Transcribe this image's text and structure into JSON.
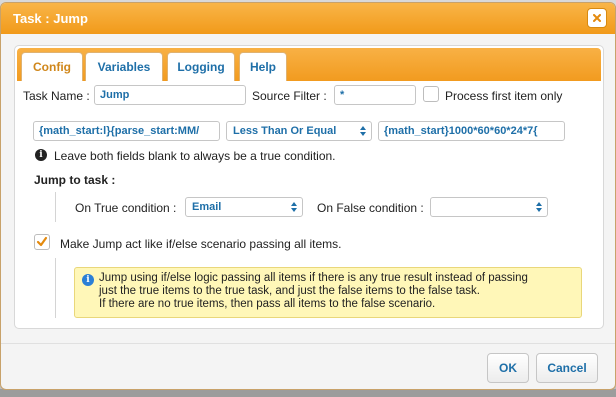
{
  "dialog": {
    "title": "Task : Jump"
  },
  "tabs": [
    {
      "label": "Config",
      "active": true
    },
    {
      "label": "Variables",
      "active": false
    },
    {
      "label": "Logging",
      "active": false
    },
    {
      "label": "Help",
      "active": false
    }
  ],
  "config": {
    "task_name_label": "Task Name :",
    "task_name_value": "Jump",
    "source_filter_label": "Source Filter :",
    "source_filter_value": "*",
    "process_first_label": "Process first item only",
    "process_first_checked": false,
    "condition_left_value": "{math_start:l}{parse_start:MM/",
    "condition_operator": "Less Than Or Equal",
    "condition_right_value": "{math_start}1000*60*60*24*7{",
    "condition_hint": "Leave both fields blank to always be a true condition.",
    "jump_to_task_label": "Jump to task :",
    "on_true_label": "On True condition :",
    "on_true_value": "Email",
    "on_false_label": "On False condition :",
    "on_false_value": "",
    "ifelse_label": "Make Jump act like if/else scenario passing all items.",
    "ifelse_checked": true,
    "notice_lines": [
      "Jump using if/else logic passing all items if there is any true result instead of passing",
      "just the true items to the true task, and just the false items to the false task.",
      "If there are no true items, then pass all items to the false scenario."
    ]
  },
  "buttons": {
    "ok": "OK",
    "cancel": "Cancel"
  },
  "colors": {
    "accent": "#f19a1a",
    "link": "#1e6fa8",
    "notice_bg": "#fff7b8",
    "info_blue": "#2b7fd6"
  },
  "icons": {
    "close": "close-icon",
    "checkmark": "checkmark-icon",
    "info": "info-icon",
    "select_arrows": "select-arrows-icon"
  }
}
